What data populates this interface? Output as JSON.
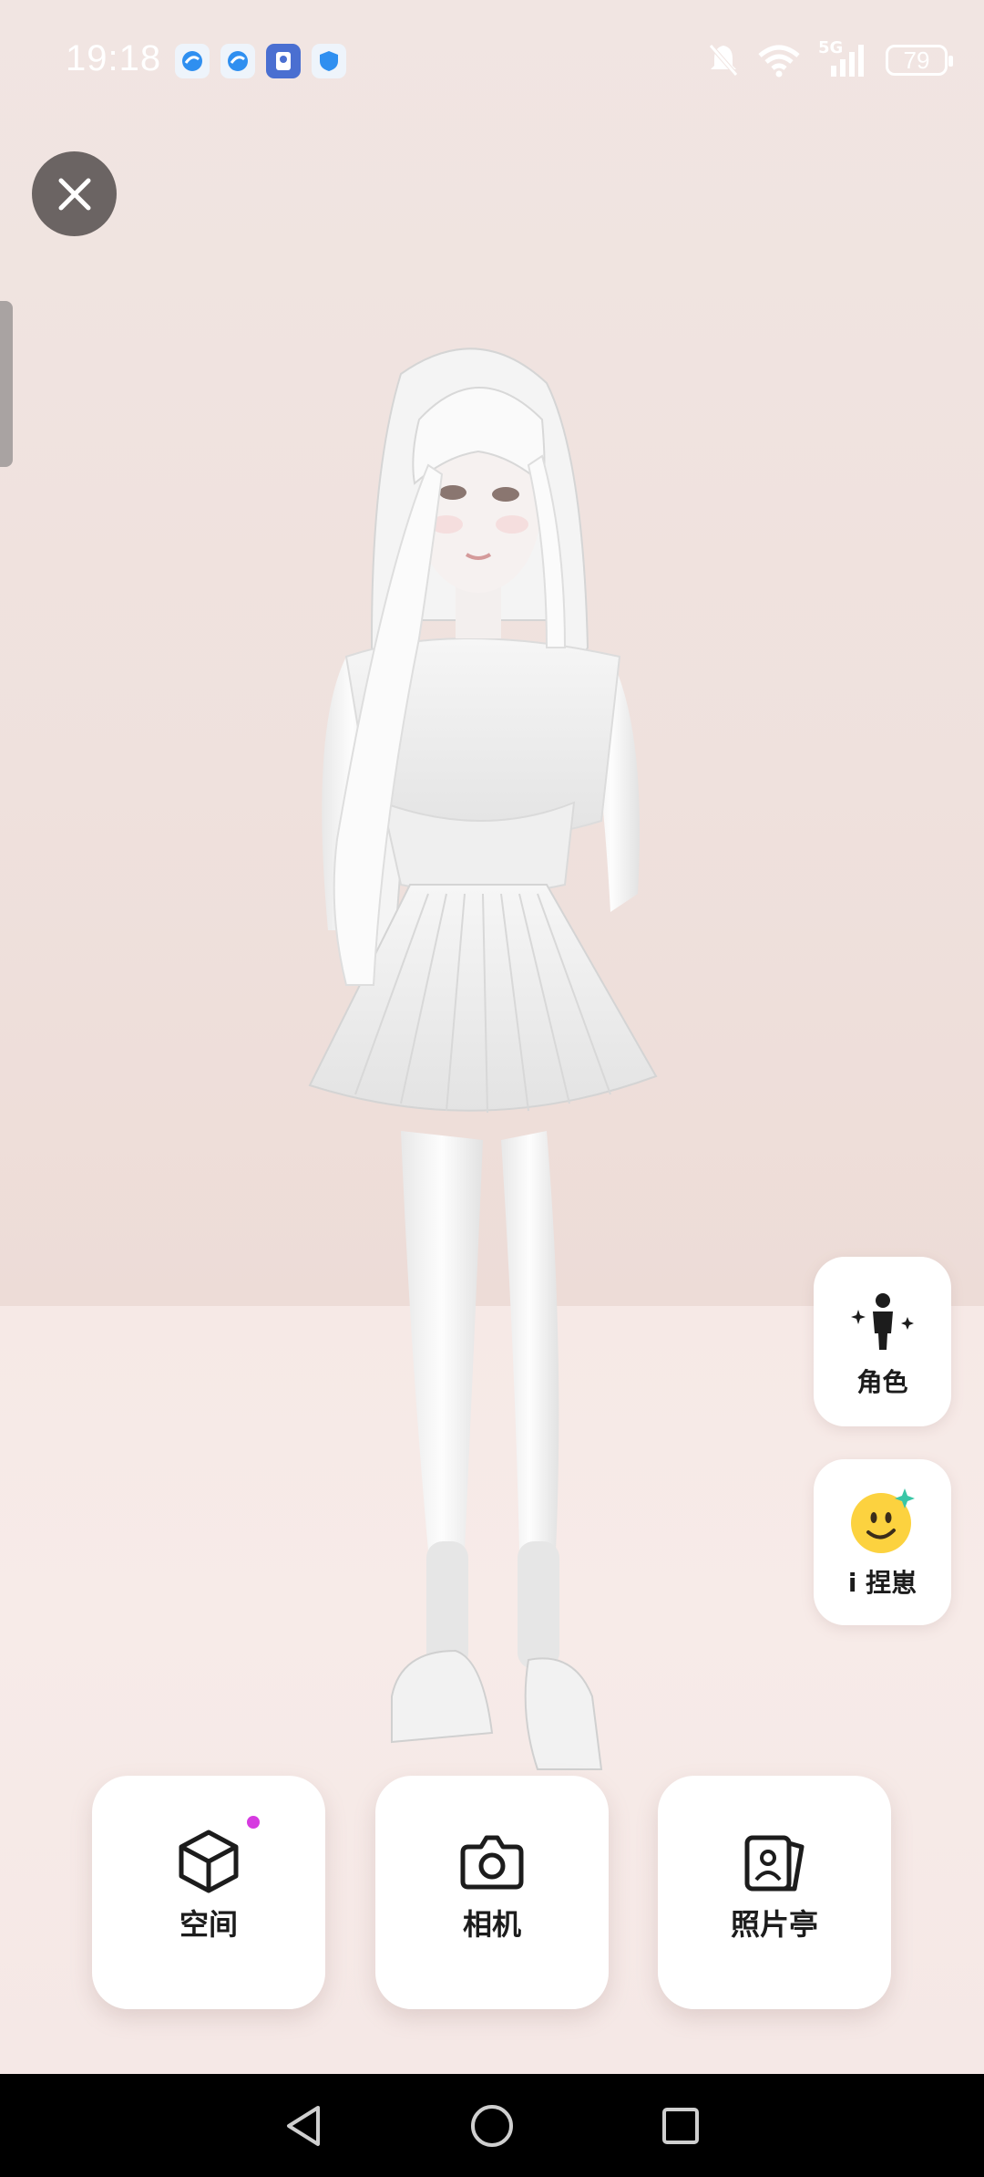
{
  "status_bar": {
    "time": "19:18",
    "battery": "79",
    "network": "5G",
    "icons": [
      "app-notification-icon",
      "app-notification-icon",
      "app-store-icon",
      "shield-icon",
      "mute-icon",
      "wifi-icon",
      "signal-icon",
      "battery-icon"
    ]
  },
  "scene": {
    "close_icon": "close-icon",
    "side_handle": "drawer-handle"
  },
  "side_actions": [
    {
      "label": "角色",
      "icon": "avatar-sparkle-icon"
    },
    {
      "label": "i 捏崽",
      "icon": "face-sparkle-icon"
    }
  ],
  "bottom_actions": [
    {
      "label": "空间",
      "icon": "cube-icon",
      "has_badge": true
    },
    {
      "label": "相机",
      "icon": "camera-icon"
    },
    {
      "label": "照片亭",
      "icon": "photo-booth-icon"
    }
  ],
  "nav": [
    "back-icon",
    "home-icon",
    "recents-icon"
  ],
  "colors": {
    "background_wall": "#efe1dd",
    "background_floor": "#f7ebe8",
    "badge": "#d63be0",
    "close_button": "#6b6463"
  }
}
